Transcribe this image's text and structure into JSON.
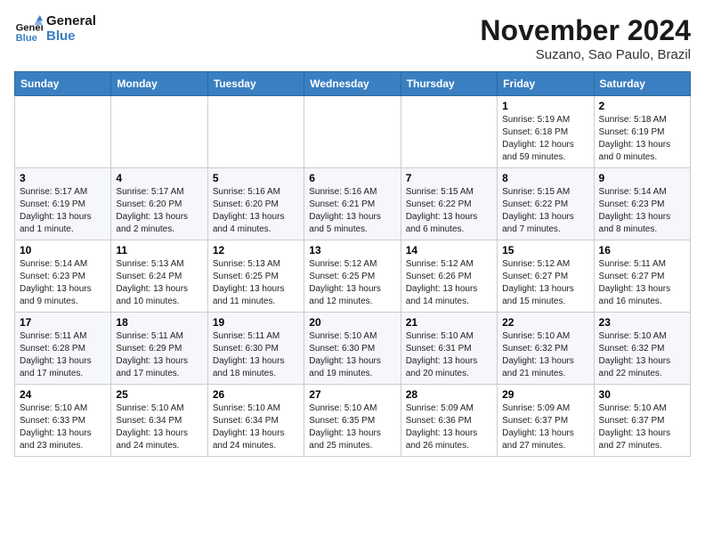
{
  "logo": {
    "line1": "General",
    "line2": "Blue"
  },
  "title": "November 2024",
  "location": "Suzano, Sao Paulo, Brazil",
  "weekdays": [
    "Sunday",
    "Monday",
    "Tuesday",
    "Wednesday",
    "Thursday",
    "Friday",
    "Saturday"
  ],
  "weeks": [
    [
      {
        "day": "",
        "detail": ""
      },
      {
        "day": "",
        "detail": ""
      },
      {
        "day": "",
        "detail": ""
      },
      {
        "day": "",
        "detail": ""
      },
      {
        "day": "",
        "detail": ""
      },
      {
        "day": "1",
        "detail": "Sunrise: 5:19 AM\nSunset: 6:18 PM\nDaylight: 12 hours\nand 59 minutes."
      },
      {
        "day": "2",
        "detail": "Sunrise: 5:18 AM\nSunset: 6:19 PM\nDaylight: 13 hours\nand 0 minutes."
      }
    ],
    [
      {
        "day": "3",
        "detail": "Sunrise: 5:17 AM\nSunset: 6:19 PM\nDaylight: 13 hours\nand 1 minute."
      },
      {
        "day": "4",
        "detail": "Sunrise: 5:17 AM\nSunset: 6:20 PM\nDaylight: 13 hours\nand 2 minutes."
      },
      {
        "day": "5",
        "detail": "Sunrise: 5:16 AM\nSunset: 6:20 PM\nDaylight: 13 hours\nand 4 minutes."
      },
      {
        "day": "6",
        "detail": "Sunrise: 5:16 AM\nSunset: 6:21 PM\nDaylight: 13 hours\nand 5 minutes."
      },
      {
        "day": "7",
        "detail": "Sunrise: 5:15 AM\nSunset: 6:22 PM\nDaylight: 13 hours\nand 6 minutes."
      },
      {
        "day": "8",
        "detail": "Sunrise: 5:15 AM\nSunset: 6:22 PM\nDaylight: 13 hours\nand 7 minutes."
      },
      {
        "day": "9",
        "detail": "Sunrise: 5:14 AM\nSunset: 6:23 PM\nDaylight: 13 hours\nand 8 minutes."
      }
    ],
    [
      {
        "day": "10",
        "detail": "Sunrise: 5:14 AM\nSunset: 6:23 PM\nDaylight: 13 hours\nand 9 minutes."
      },
      {
        "day": "11",
        "detail": "Sunrise: 5:13 AM\nSunset: 6:24 PM\nDaylight: 13 hours\nand 10 minutes."
      },
      {
        "day": "12",
        "detail": "Sunrise: 5:13 AM\nSunset: 6:25 PM\nDaylight: 13 hours\nand 11 minutes."
      },
      {
        "day": "13",
        "detail": "Sunrise: 5:12 AM\nSunset: 6:25 PM\nDaylight: 13 hours\nand 12 minutes."
      },
      {
        "day": "14",
        "detail": "Sunrise: 5:12 AM\nSunset: 6:26 PM\nDaylight: 13 hours\nand 14 minutes."
      },
      {
        "day": "15",
        "detail": "Sunrise: 5:12 AM\nSunset: 6:27 PM\nDaylight: 13 hours\nand 15 minutes."
      },
      {
        "day": "16",
        "detail": "Sunrise: 5:11 AM\nSunset: 6:27 PM\nDaylight: 13 hours\nand 16 minutes."
      }
    ],
    [
      {
        "day": "17",
        "detail": "Sunrise: 5:11 AM\nSunset: 6:28 PM\nDaylight: 13 hours\nand 17 minutes."
      },
      {
        "day": "18",
        "detail": "Sunrise: 5:11 AM\nSunset: 6:29 PM\nDaylight: 13 hours\nand 17 minutes."
      },
      {
        "day": "19",
        "detail": "Sunrise: 5:11 AM\nSunset: 6:30 PM\nDaylight: 13 hours\nand 18 minutes."
      },
      {
        "day": "20",
        "detail": "Sunrise: 5:10 AM\nSunset: 6:30 PM\nDaylight: 13 hours\nand 19 minutes."
      },
      {
        "day": "21",
        "detail": "Sunrise: 5:10 AM\nSunset: 6:31 PM\nDaylight: 13 hours\nand 20 minutes."
      },
      {
        "day": "22",
        "detail": "Sunrise: 5:10 AM\nSunset: 6:32 PM\nDaylight: 13 hours\nand 21 minutes."
      },
      {
        "day": "23",
        "detail": "Sunrise: 5:10 AM\nSunset: 6:32 PM\nDaylight: 13 hours\nand 22 minutes."
      }
    ],
    [
      {
        "day": "24",
        "detail": "Sunrise: 5:10 AM\nSunset: 6:33 PM\nDaylight: 13 hours\nand 23 minutes."
      },
      {
        "day": "25",
        "detail": "Sunrise: 5:10 AM\nSunset: 6:34 PM\nDaylight: 13 hours\nand 24 minutes."
      },
      {
        "day": "26",
        "detail": "Sunrise: 5:10 AM\nSunset: 6:34 PM\nDaylight: 13 hours\nand 24 minutes."
      },
      {
        "day": "27",
        "detail": "Sunrise: 5:10 AM\nSunset: 6:35 PM\nDaylight: 13 hours\nand 25 minutes."
      },
      {
        "day": "28",
        "detail": "Sunrise: 5:09 AM\nSunset: 6:36 PM\nDaylight: 13 hours\nand 26 minutes."
      },
      {
        "day": "29",
        "detail": "Sunrise: 5:09 AM\nSunset: 6:37 PM\nDaylight: 13 hours\nand 27 minutes."
      },
      {
        "day": "30",
        "detail": "Sunrise: 5:10 AM\nSunset: 6:37 PM\nDaylight: 13 hours\nand 27 minutes."
      }
    ]
  ]
}
